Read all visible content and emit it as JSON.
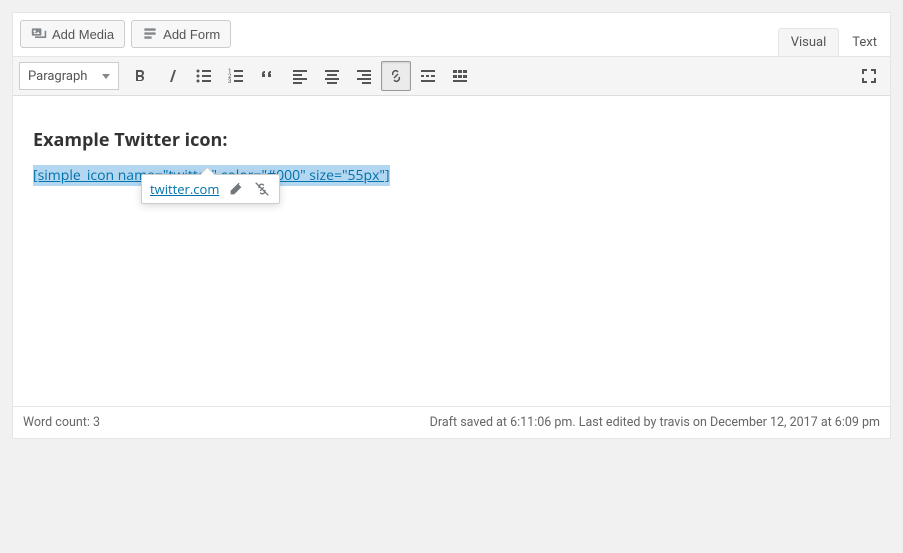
{
  "media_buttons": {
    "add_media": "Add Media",
    "add_form": "Add Form"
  },
  "tabs": {
    "visual": "Visual",
    "text": "Text",
    "active": "visual"
  },
  "toolbar": {
    "format_label": "Paragraph"
  },
  "content": {
    "heading": "Example Twitter icon:",
    "shortcode": "[simple_icon name=\"twitter\" color=\"#000\" size=\"55px\"]"
  },
  "link_popup": {
    "url": "twitter.com"
  },
  "status": {
    "word_count": "Word count: 3",
    "save_info": "Draft saved at 6:11:06 pm. Last edited by travis on December 12, 2017 at 6:09 pm"
  }
}
